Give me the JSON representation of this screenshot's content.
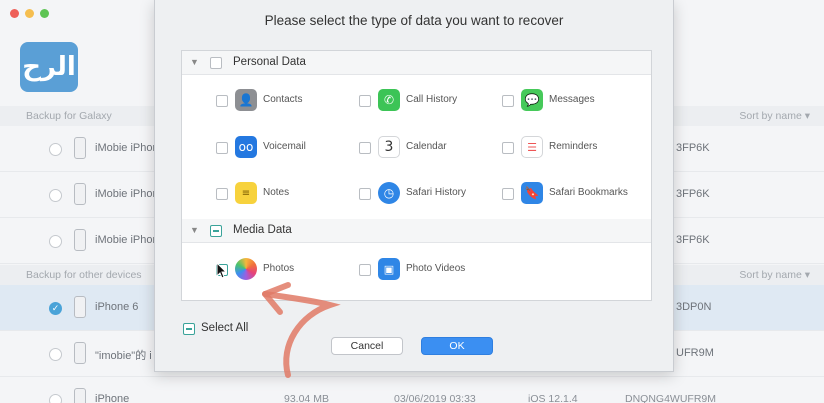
{
  "window": {
    "logo_text": "الرح"
  },
  "background": {
    "galaxy_header": "Backup for Galaxy",
    "other_header": "Backup for other devices",
    "sort_label": "Sort by name ▾",
    "rows": [
      {
        "name": "iMobie iPhon",
        "serial": "3FP6K"
      },
      {
        "name": "iMobie iPhon",
        "serial": "3FP6K"
      },
      {
        "name": "iMobie iPhon",
        "serial": "3FP6K"
      },
      {
        "name": "iPhone 6",
        "serial": "3DP0N"
      },
      {
        "name": "\"imobie\"的 i",
        "serial": "UFR9M"
      },
      {
        "name": "iPhone",
        "size": "93.04 MB",
        "date": "03/06/2019 03:33",
        "ios": "iOS 12.1.4",
        "serial": "DNQNG4WUFR9M"
      }
    ]
  },
  "dialog": {
    "title": "Please select the type of data you want to recover",
    "groups": [
      {
        "label": "Personal Data",
        "items": [
          {
            "label": "Contacts",
            "icon": "contacts-icon"
          },
          {
            "label": "Call History",
            "icon": "phone-icon"
          },
          {
            "label": "Messages",
            "icon": "messages-icon"
          },
          {
            "label": "Voicemail",
            "icon": "voicemail-icon"
          },
          {
            "label": "Calendar",
            "icon": "calendar-icon",
            "glyph": "3"
          },
          {
            "label": "Reminders",
            "icon": "reminders-icon"
          },
          {
            "label": "Notes",
            "icon": "notes-icon"
          },
          {
            "label": "Safari History",
            "icon": "safari-history-icon"
          },
          {
            "label": "Safari Bookmarks",
            "icon": "safari-bookmarks-icon"
          }
        ]
      },
      {
        "label": "Media Data",
        "items": [
          {
            "label": "Photos",
            "icon": "photos-icon"
          },
          {
            "label": "Photo Videos",
            "icon": "photo-videos-icon"
          }
        ]
      }
    ],
    "select_all_label": "Select All",
    "cancel_label": "Cancel",
    "ok_label": "OK"
  },
  "colors": {
    "accent": "#3b8ff2",
    "teal_check": "#3aa39a",
    "arrow": "#e07a66"
  }
}
